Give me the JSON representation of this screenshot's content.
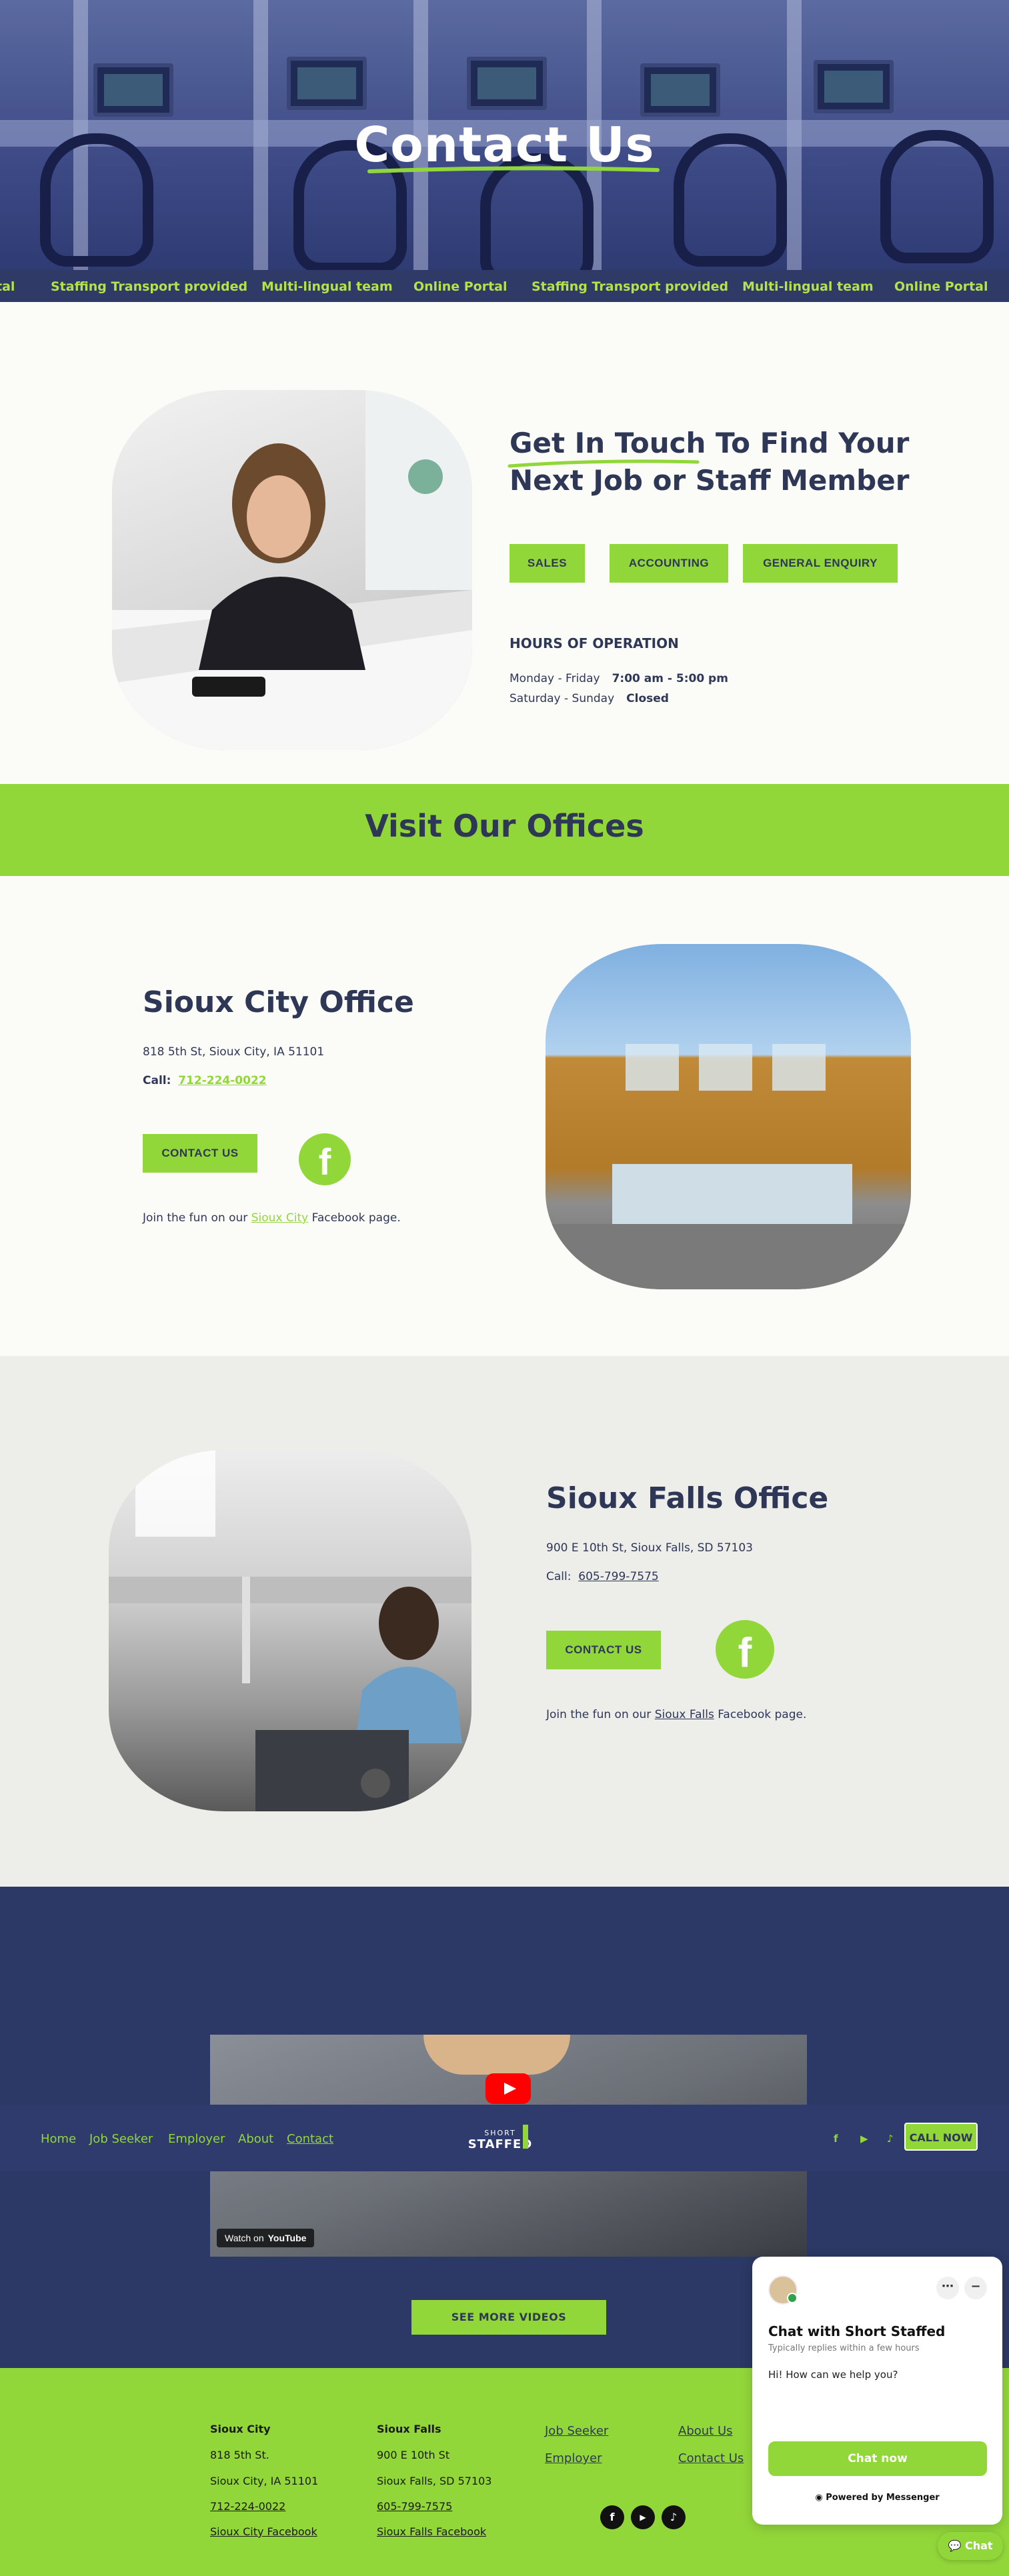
{
  "hero": {
    "title": "Contact Us"
  },
  "ticker": {
    "items": [
      "tal",
      "Staffing Transport provided",
      "Multi-lingual team",
      "Online Portal",
      "Staffing Transport provided",
      "Multi-lingual team",
      "Online Portal"
    ]
  },
  "touch": {
    "title_highlight": "Get In Touch",
    "title_rest_1": " To Find Your",
    "title_line2": "Next Job or Staff Member",
    "buttons": {
      "sales": "SALES",
      "accounting": "ACCOUNTING",
      "general": "GENERAL ENQUIRY"
    },
    "hours_title": "HOURS OF OPERATION",
    "hours": [
      {
        "days": "Monday - Friday",
        "time": "7:00 am - 5:00 pm"
      },
      {
        "days": "Saturday - Sunday",
        "time": "Closed"
      }
    ]
  },
  "visit": {
    "title": "Visit Our Offices"
  },
  "sioux_city": {
    "title": "Sioux City Office",
    "address": "818 5th St, Sioux City, IA 51101",
    "call_label": "Call:",
    "phone": "712-224-0022",
    "contact_button": "CONTACT US",
    "fb_prefix": "Join the fun on our ",
    "fb_link": "Sioux City",
    "fb_suffix": " Facebook page."
  },
  "sioux_falls": {
    "title": "Sioux Falls Office",
    "address": "900 E 10th St, Sioux Falls, SD 57103",
    "call_label": "Call:",
    "phone": "605-799-7575",
    "contact_button": "CONTACT US",
    "fb_prefix": "Join the fun on our ",
    "fb_link": "Sioux Falls",
    "fb_suffix": " Facebook page."
  },
  "video": {
    "watch_on": "Watch on",
    "youtube": "YouTube",
    "see_more": "SEE MORE VIDEOS"
  },
  "nav": {
    "links": [
      "Home",
      "Job Seeker",
      "Employer",
      "About",
      "Contact"
    ],
    "logo_line1": "SHORT",
    "logo_line2": "STAFFED",
    "call_now": "CALL NOW",
    "icons": [
      "facebook-icon",
      "youtube-icon",
      "tiktok-icon"
    ]
  },
  "footer": {
    "sioux_city": {
      "heading": "Sioux City",
      "line1": "818 5th St.",
      "line2": "Sioux City, IA 51101",
      "phone": "712-224-0022",
      "facebook": "Sioux City Facebook"
    },
    "sioux_falls": {
      "heading": "Sioux Falls",
      "line1": "900 E 10th St",
      "line2": "Sioux Falls, SD 57103",
      "phone": "605-799-7575",
      "facebook": "Sioux Falls Facebook"
    },
    "links_col1": [
      "Job Seeker",
      "Employer"
    ],
    "links_col2": [
      "About Us",
      "Contact Us"
    ]
  },
  "chat": {
    "title": "Chat with Short Staffed",
    "subtitle": "Typically replies within a few hours",
    "greeting": "Hi! How can we help you?",
    "button": "Chat now",
    "powered": "Powered by Messenger",
    "pill": "Chat"
  },
  "colors": {
    "accent": "#92d73a",
    "navy": "#2e3756",
    "dark_band": "#2c3865"
  }
}
